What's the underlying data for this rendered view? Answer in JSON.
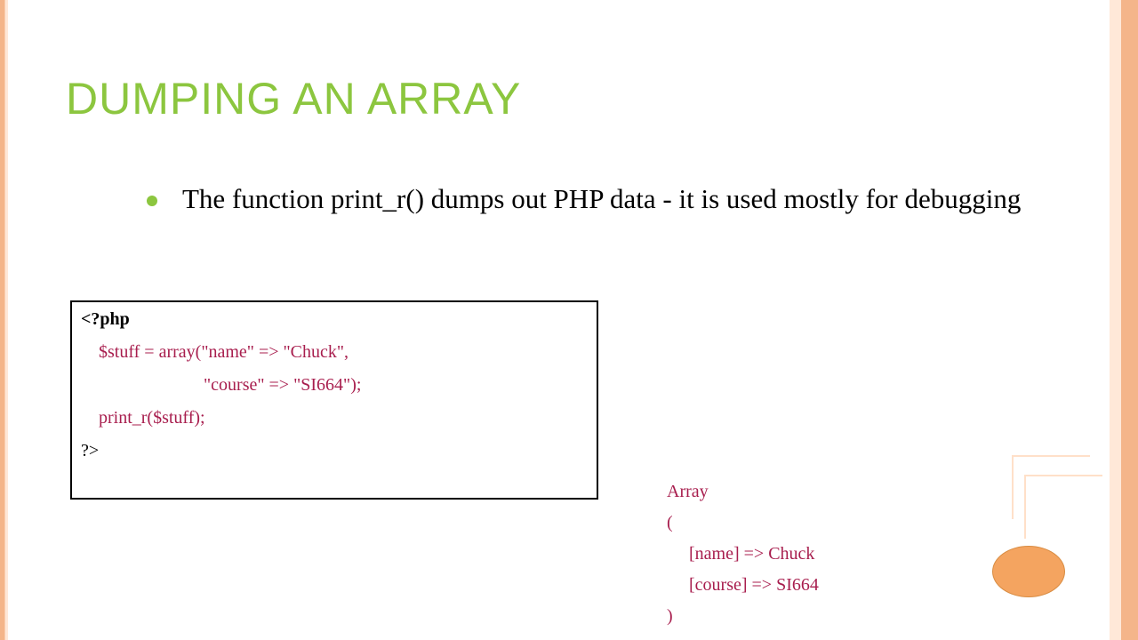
{
  "title": "DUMPING AN ARRAY",
  "bullet": "The function print_r() dumps out PHP data - it is used mostly for debugging",
  "code": {
    "open": "<?php",
    "line1": "$stuff = array(\"name\" => \"Chuck\",",
    "line2": "\"course\" => \"SI664\");",
    "line3": "print_r($stuff);",
    "close": "?>"
  },
  "output": {
    "l1": "Array",
    "l2": "(",
    "l3": "[name] => Chuck",
    "l4": "[course] => SI664",
    "l5": ")"
  }
}
